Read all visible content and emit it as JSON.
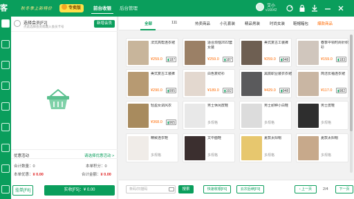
{
  "header": {
    "logo": "客",
    "slogan": "秋冬季上新特价",
    "vip_label": "专卖版",
    "tabs": [
      "前台收银",
      "后台管理"
    ],
    "user_name": "艾小",
    "user_id": "v16642"
  },
  "cart": {
    "member_title": "选择会员[F2]",
    "member_sub": "点此选择会员或输入会员卡号",
    "add_member": "新增会员",
    "promo_label": "优惠活动",
    "promo_link": "请选择优惠活动 >",
    "count_label": "合计数量：0",
    "points_label": "本单积分：0",
    "discount_label": "本单优惠：",
    "discount_value": "¥ 0.00",
    "amount_label": "合计金额：",
    "amount_value": "¥ 0.00",
    "hold_button": "挂单[F8]",
    "pay_button": "实收[F5]：¥ 0.00"
  },
  "categories": [
    "全部",
    "111",
    "热卖商品",
    "小孔套装",
    "精品男装",
    "时尚女装",
    "鞋帽箱包",
    "爆款商品"
  ],
  "products": [
    {
      "name": "法式高帮连衣裙",
      "price": "¥259.0",
      "stock": "187",
      "multi": "",
      "color": "#c8b59b"
    },
    {
      "name": "适合烦恼2022套女装",
      "price": "¥259.0",
      "stock": "187",
      "multi": "",
      "color": "#9b8066"
    },
    {
      "name": "美式复古工装裤",
      "price": "¥259.0",
      "stock": "948",
      "multi": "",
      "color": "#6e5f52"
    },
    {
      "name": "春季中领时尚针织衫",
      "price": "¥159.0",
      "stock": "183",
      "multi": "",
      "color": "#d0c6bd"
    },
    {
      "name": "美式复古工装裤",
      "price": "¥290.0",
      "stock": "995",
      "multi": "",
      "color": "#b79a72"
    },
    {
      "name": "白色复纺衫",
      "price": "¥189.0",
      "stock": "192",
      "multi": "",
      "color": "#e3d8cf"
    },
    {
      "name": "黑底职业装衣衣裙",
      "price": "¥429.0",
      "stock": "948",
      "multi": "",
      "color": "#5a5a5c"
    },
    {
      "name": "简洁长袖连衣裙",
      "price": "¥117.0",
      "stock": "982",
      "multi": "",
      "color": "#c9b6a3"
    },
    {
      "name": "轻盈女调风衣",
      "price": "¥368.0",
      "stock": "965",
      "multi": "",
      "color": "#a88b5e"
    },
    {
      "name": "男士休闲皮鞋",
      "price": "",
      "stock": "",
      "multi": "多规格",
      "color": "#e8e8e8"
    },
    {
      "name": "男士耐种小白鞋",
      "price": "",
      "stock": "",
      "multi": "多规格",
      "color": "#dcdcdc"
    },
    {
      "name": "男士皮鞋",
      "price": "",
      "stock": "",
      "multi": "多规格",
      "color": "#2e2e2e"
    },
    {
      "name": "精致连衣鞋",
      "price": "",
      "stock": "",
      "multi": "多规格",
      "color": "#f0ece8"
    },
    {
      "name": "文中面鞋",
      "price": "",
      "stock": "",
      "multi": "多规格",
      "color": "#3b2f2f"
    },
    {
      "name": "夏款太阳帽",
      "price": "",
      "stock": "",
      "multi": "多规格",
      "color": "#e7c76e"
    },
    {
      "name": "夏款太阳帽",
      "price": "",
      "stock": "",
      "multi": "多规格",
      "color": "#c7a98b"
    }
  ],
  "bottom": {
    "search_placeholder": "条码/扫描码",
    "search_button": "搜索",
    "quick_out": "快速收银[F6]",
    "pending": "云次后续[F9]",
    "prev_page": "上一页",
    "page_info": "2/4",
    "next_page": "下一页"
  }
}
